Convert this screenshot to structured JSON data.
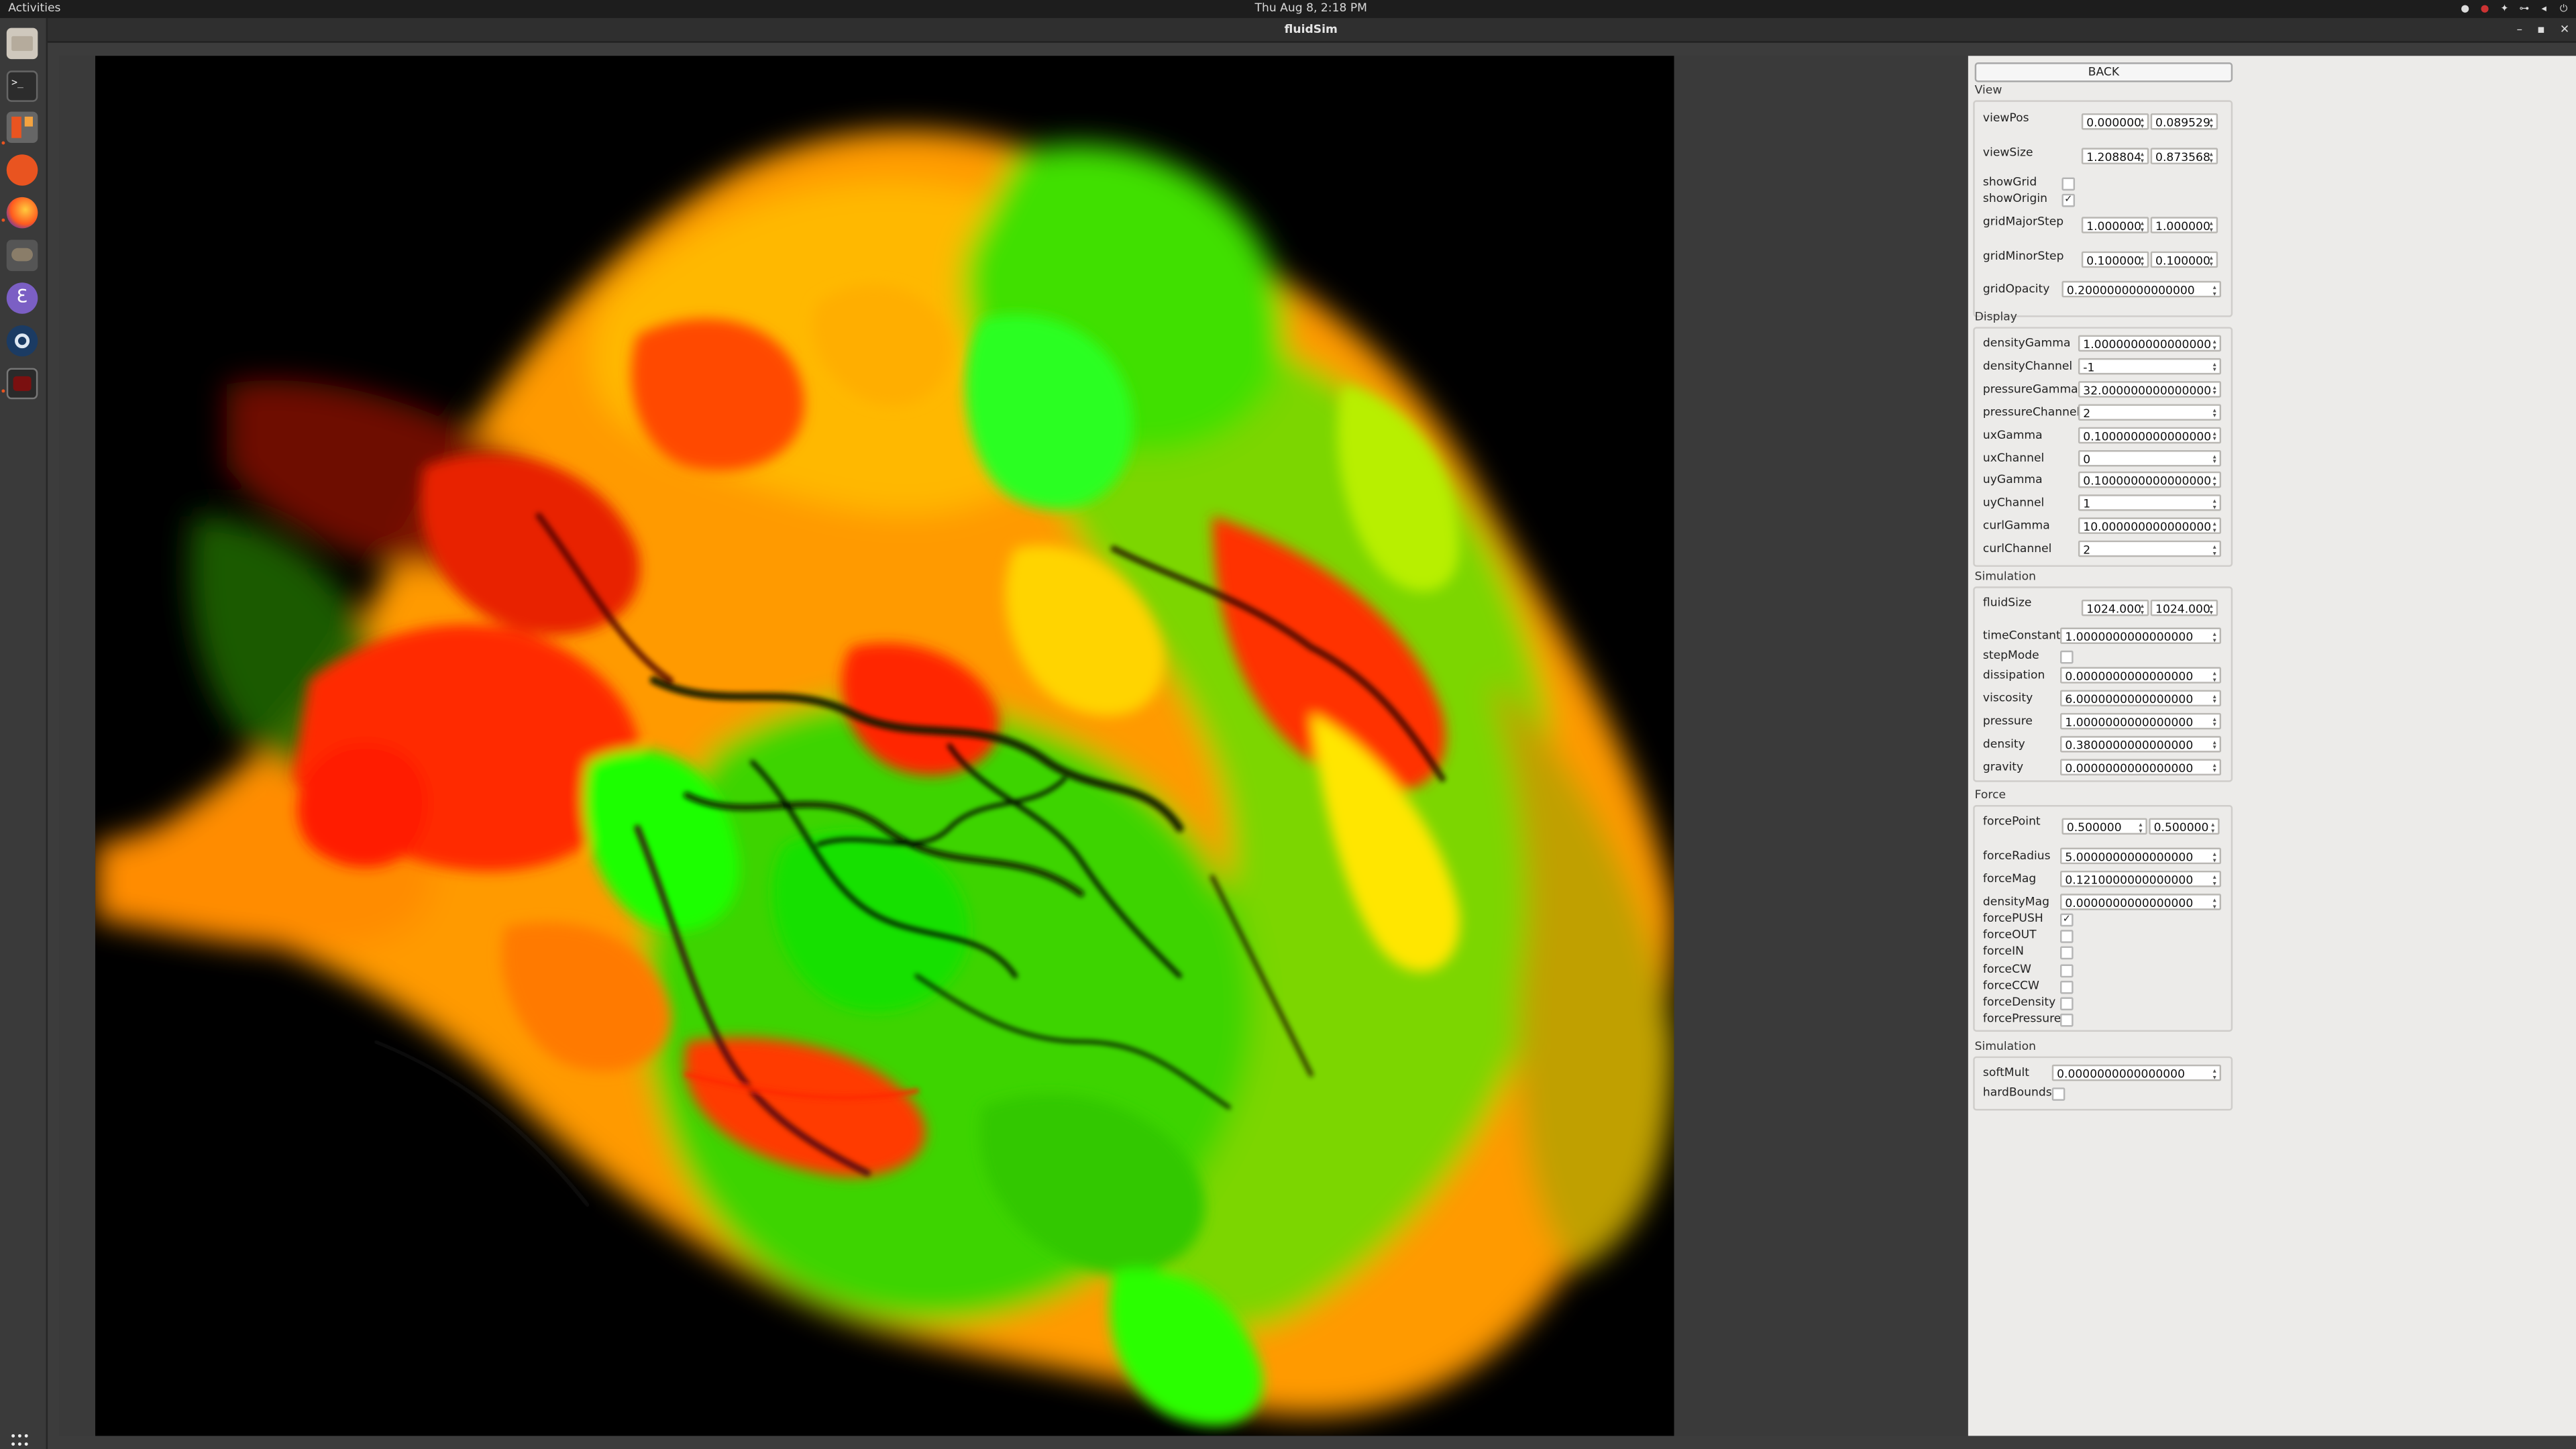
{
  "topbar": {
    "activities": "Activities",
    "clock": "Thu Aug 8, 2:18 PM"
  },
  "window": {
    "title": "fluidSim"
  },
  "dock": {
    "items": [
      "files-icon",
      "terminal-icon",
      "app-icon",
      "software-icon",
      "firefox-icon",
      "gimp-icon",
      "emacs-icon",
      "steam-icon",
      "fluidsim-icon"
    ]
  },
  "panel": {
    "back": "BACK",
    "view": {
      "title": "View",
      "viewPos": {
        "label": "viewPos",
        "a": "0.000000",
        "b": "0.089529"
      },
      "viewSize": {
        "label": "viewSize",
        "a": "1.208804",
        "b": "0.873568"
      },
      "showGrid": {
        "label": "showGrid",
        "checked": false
      },
      "showOrigin": {
        "label": "showOrigin",
        "checked": true
      },
      "gridMajorStep": {
        "label": "gridMajorStep",
        "a": "1.000000",
        "b": "1.000000"
      },
      "gridMinorStep": {
        "label": "gridMinorStep",
        "a": "0.100000",
        "b": "0.100000"
      },
      "gridOpacity": {
        "label": "gridOpacity",
        "value": "0.2000000000000000"
      }
    },
    "display": {
      "title": "Display",
      "rows": [
        {
          "label": "densityGamma",
          "value": "1.0000000000000000"
        },
        {
          "label": "densityChannel",
          "value": "-1"
        },
        {
          "label": "pressureGamma",
          "value": "32.000000000000000"
        },
        {
          "label": "pressureChannel",
          "value": "2"
        },
        {
          "label": "uxGamma",
          "value": "0.1000000000000000"
        },
        {
          "label": "uxChannel",
          "value": "0"
        },
        {
          "label": "uyGamma",
          "value": "0.1000000000000000"
        },
        {
          "label": "uyChannel",
          "value": "1"
        },
        {
          "label": "curlGamma",
          "value": "10.000000000000000"
        },
        {
          "label": "curlChannel",
          "value": "2"
        }
      ]
    },
    "simulation": {
      "title": "Simulation",
      "fluidSize": {
        "label": "fluidSize",
        "a": "1024.000",
        "b": "1024.000"
      },
      "timeConstant": {
        "label": "timeConstant",
        "value": "1.0000000000000000"
      },
      "stepMode": {
        "label": "stepMode",
        "checked": false
      },
      "rows": [
        {
          "label": "dissipation",
          "value": "0.0000000000000000"
        },
        {
          "label": "viscosity",
          "value": "6.0000000000000000"
        },
        {
          "label": "pressure",
          "value": "1.0000000000000000"
        },
        {
          "label": "density",
          "value": "0.3800000000000000"
        },
        {
          "label": "gravity",
          "value": "0.0000000000000000"
        }
      ]
    },
    "force": {
      "title": "Force",
      "forcePoint": {
        "label": "forcePoint",
        "a": "0.500000",
        "b": "0.500000"
      },
      "rows": [
        {
          "label": "forceRadius",
          "value": "5.0000000000000000"
        },
        {
          "label": "forceMag",
          "value": "0.1210000000000000"
        },
        {
          "label": "densityMag",
          "value": "0.0000000000000000"
        }
      ],
      "checks": [
        {
          "label": "forcePUSH",
          "checked": true
        },
        {
          "label": "forceOUT",
          "checked": false
        },
        {
          "label": "forceIN",
          "checked": false
        },
        {
          "label": "forceCW",
          "checked": false
        },
        {
          "label": "forceCCW",
          "checked": false
        },
        {
          "label": "forceDensity",
          "checked": false
        },
        {
          "label": "forcePressure",
          "checked": false
        }
      ]
    },
    "simulation2": {
      "title": "Simulation",
      "softMult": {
        "label": "softMult",
        "value": "0.0000000000000000"
      },
      "hardBounds": {
        "label": "hardBounds",
        "checked": false
      }
    }
  },
  "colors": {
    "accent_orange": "#e95420",
    "fluid_red": "#ff2a00",
    "fluid_green": "#22ff00",
    "fluid_yellow": "#ffd400"
  }
}
